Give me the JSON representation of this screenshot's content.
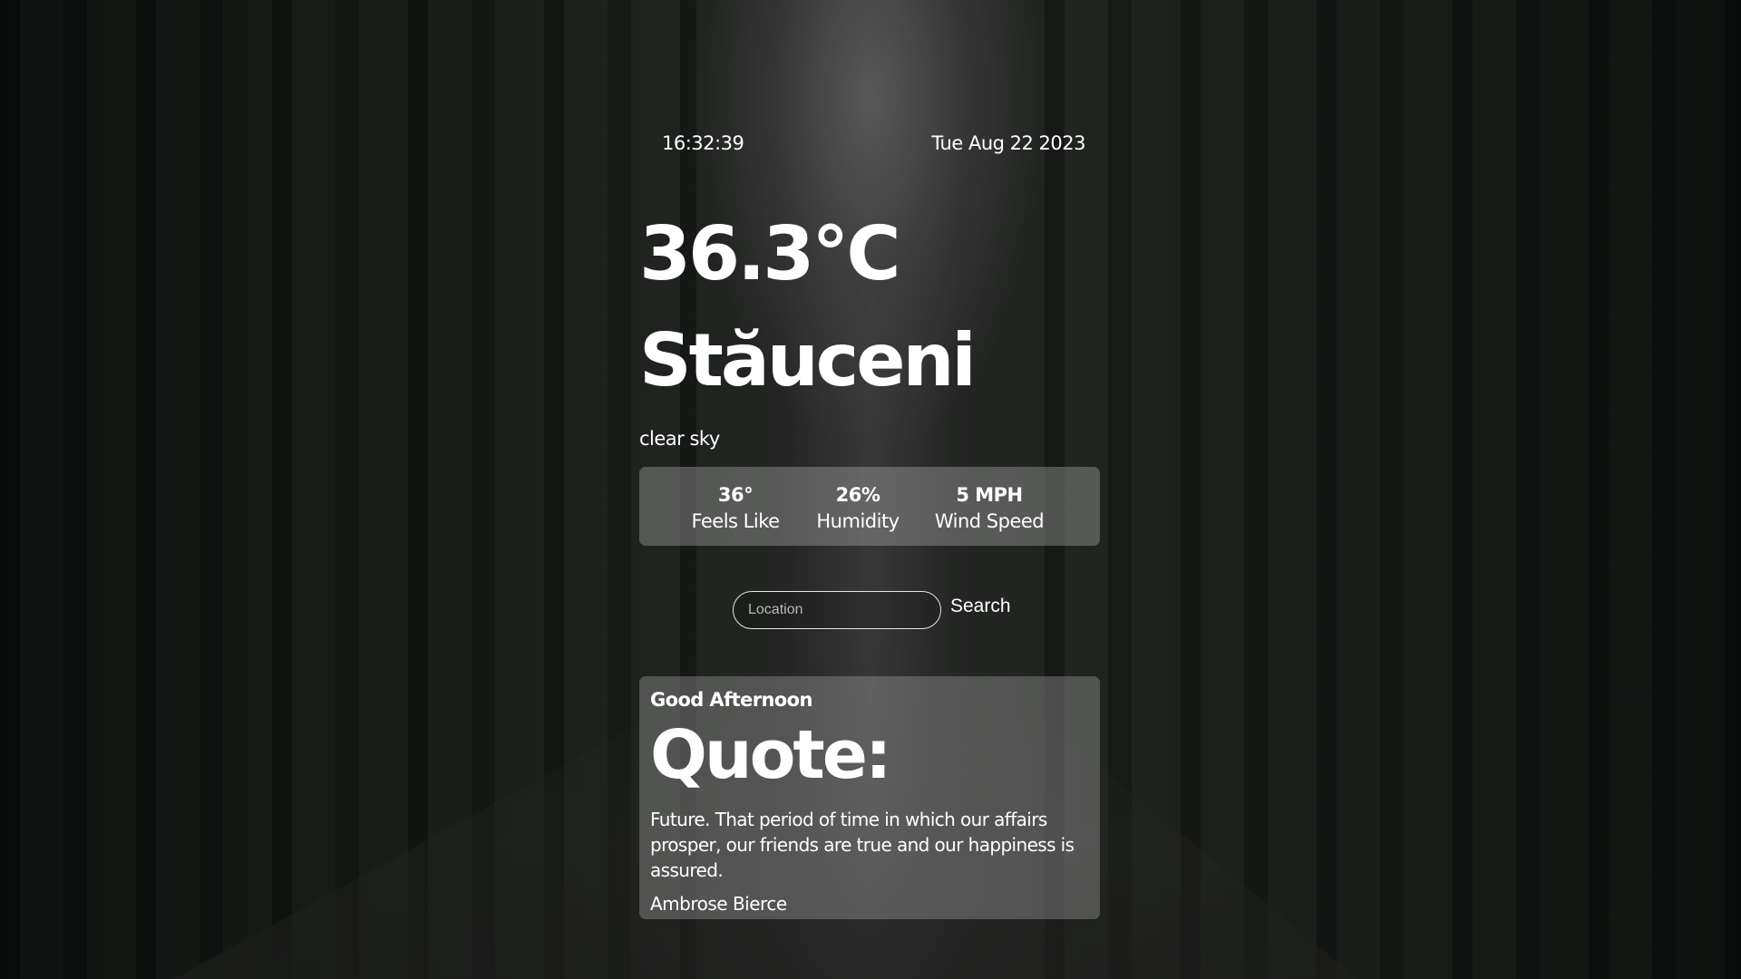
{
  "clock": {
    "time": "16:32:39",
    "date": "Tue Aug 22 2023"
  },
  "weather": {
    "temperature": "36.3°C",
    "city": "Stăuceni",
    "description": "clear sky"
  },
  "stats": {
    "feels_like": {
      "value": "36°",
      "label": "Feels Like"
    },
    "humidity": {
      "value": "26%",
      "label": "Humidity"
    },
    "wind_speed": {
      "value": "5 MPH",
      "label": "Wind Speed"
    }
  },
  "search": {
    "placeholder": "Location",
    "value": "",
    "button_label": "Search"
  },
  "quote": {
    "greeting": "Good Afternoon",
    "title": "Quote:",
    "text": "Future. That period of time in which our affairs prosper, our friends are true and our happiness is assured.",
    "author": "Ambrose Bierce"
  }
}
